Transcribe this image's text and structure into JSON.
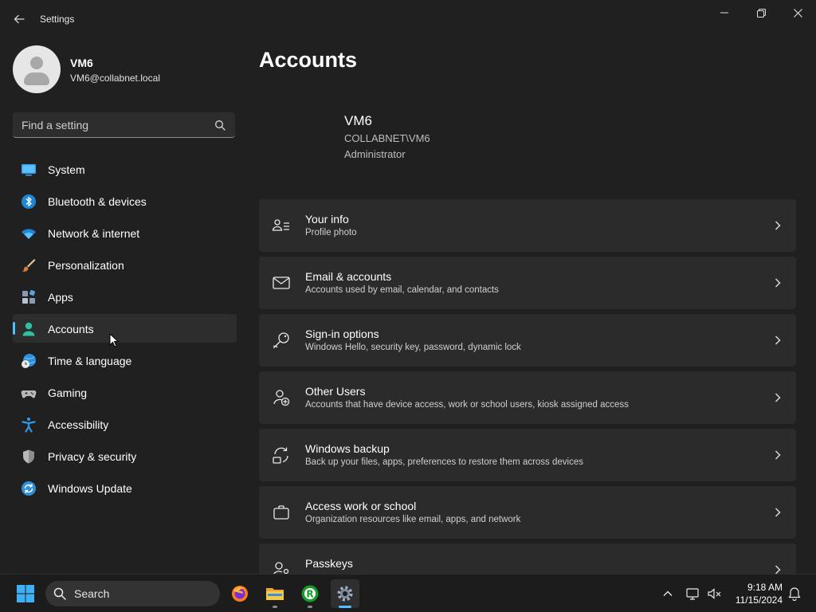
{
  "window": {
    "back_icon": "back-arrow-icon",
    "title": "Settings"
  },
  "profile": {
    "name": "VM6",
    "email": "VM6@collabnet.local"
  },
  "search": {
    "placeholder": "Find a setting"
  },
  "sidebar": {
    "items": [
      {
        "label": "System",
        "icon": "system-icon",
        "active": false
      },
      {
        "label": "Bluetooth & devices",
        "icon": "bluetooth-icon",
        "active": false
      },
      {
        "label": "Network & internet",
        "icon": "wifi-icon",
        "active": false
      },
      {
        "label": "Personalization",
        "icon": "brush-icon",
        "active": false
      },
      {
        "label": "Apps",
        "icon": "apps-icon",
        "active": false
      },
      {
        "label": "Accounts",
        "icon": "accounts-icon",
        "active": true
      },
      {
        "label": "Time & language",
        "icon": "globe-clock-icon",
        "active": false
      },
      {
        "label": "Gaming",
        "icon": "gamepad-icon",
        "active": false
      },
      {
        "label": "Accessibility",
        "icon": "accessibility-icon",
        "active": false
      },
      {
        "label": "Privacy & security",
        "icon": "shield-icon",
        "active": false
      },
      {
        "label": "Windows Update",
        "icon": "update-icon",
        "active": false
      }
    ]
  },
  "main": {
    "title": "Accounts",
    "account": {
      "name": "VM6",
      "domain": "COLLABNET\\VM6",
      "role": "Administrator"
    },
    "cards": [
      {
        "title": "Your info",
        "subtitle": "Profile photo",
        "icon": "person-info-icon"
      },
      {
        "title": "Email & accounts",
        "subtitle": "Accounts used by email, calendar, and contacts",
        "icon": "mail-icon"
      },
      {
        "title": "Sign-in options",
        "subtitle": "Windows Hello, security key, password, dynamic lock",
        "icon": "key-icon"
      },
      {
        "title": "Other Users",
        "subtitle": "Accounts that have device access, work or school users, kiosk assigned access",
        "icon": "person-add-icon"
      },
      {
        "title": "Windows backup",
        "subtitle": "Back up your files, apps, preferences to restore them across devices",
        "icon": "backup-icon"
      },
      {
        "title": "Access work or school",
        "subtitle": "Organization resources like email, apps, and network",
        "icon": "briefcase-icon"
      },
      {
        "title": "Passkeys",
        "subtitle": "",
        "icon": "passkey-icon"
      }
    ]
  },
  "taskbar": {
    "search_label": "Search",
    "time": "9:18 AM",
    "date": "11/15/2024"
  },
  "colors": {
    "accent": "#4cc2ff",
    "background": "#202020",
    "card": "#2b2b2b"
  }
}
